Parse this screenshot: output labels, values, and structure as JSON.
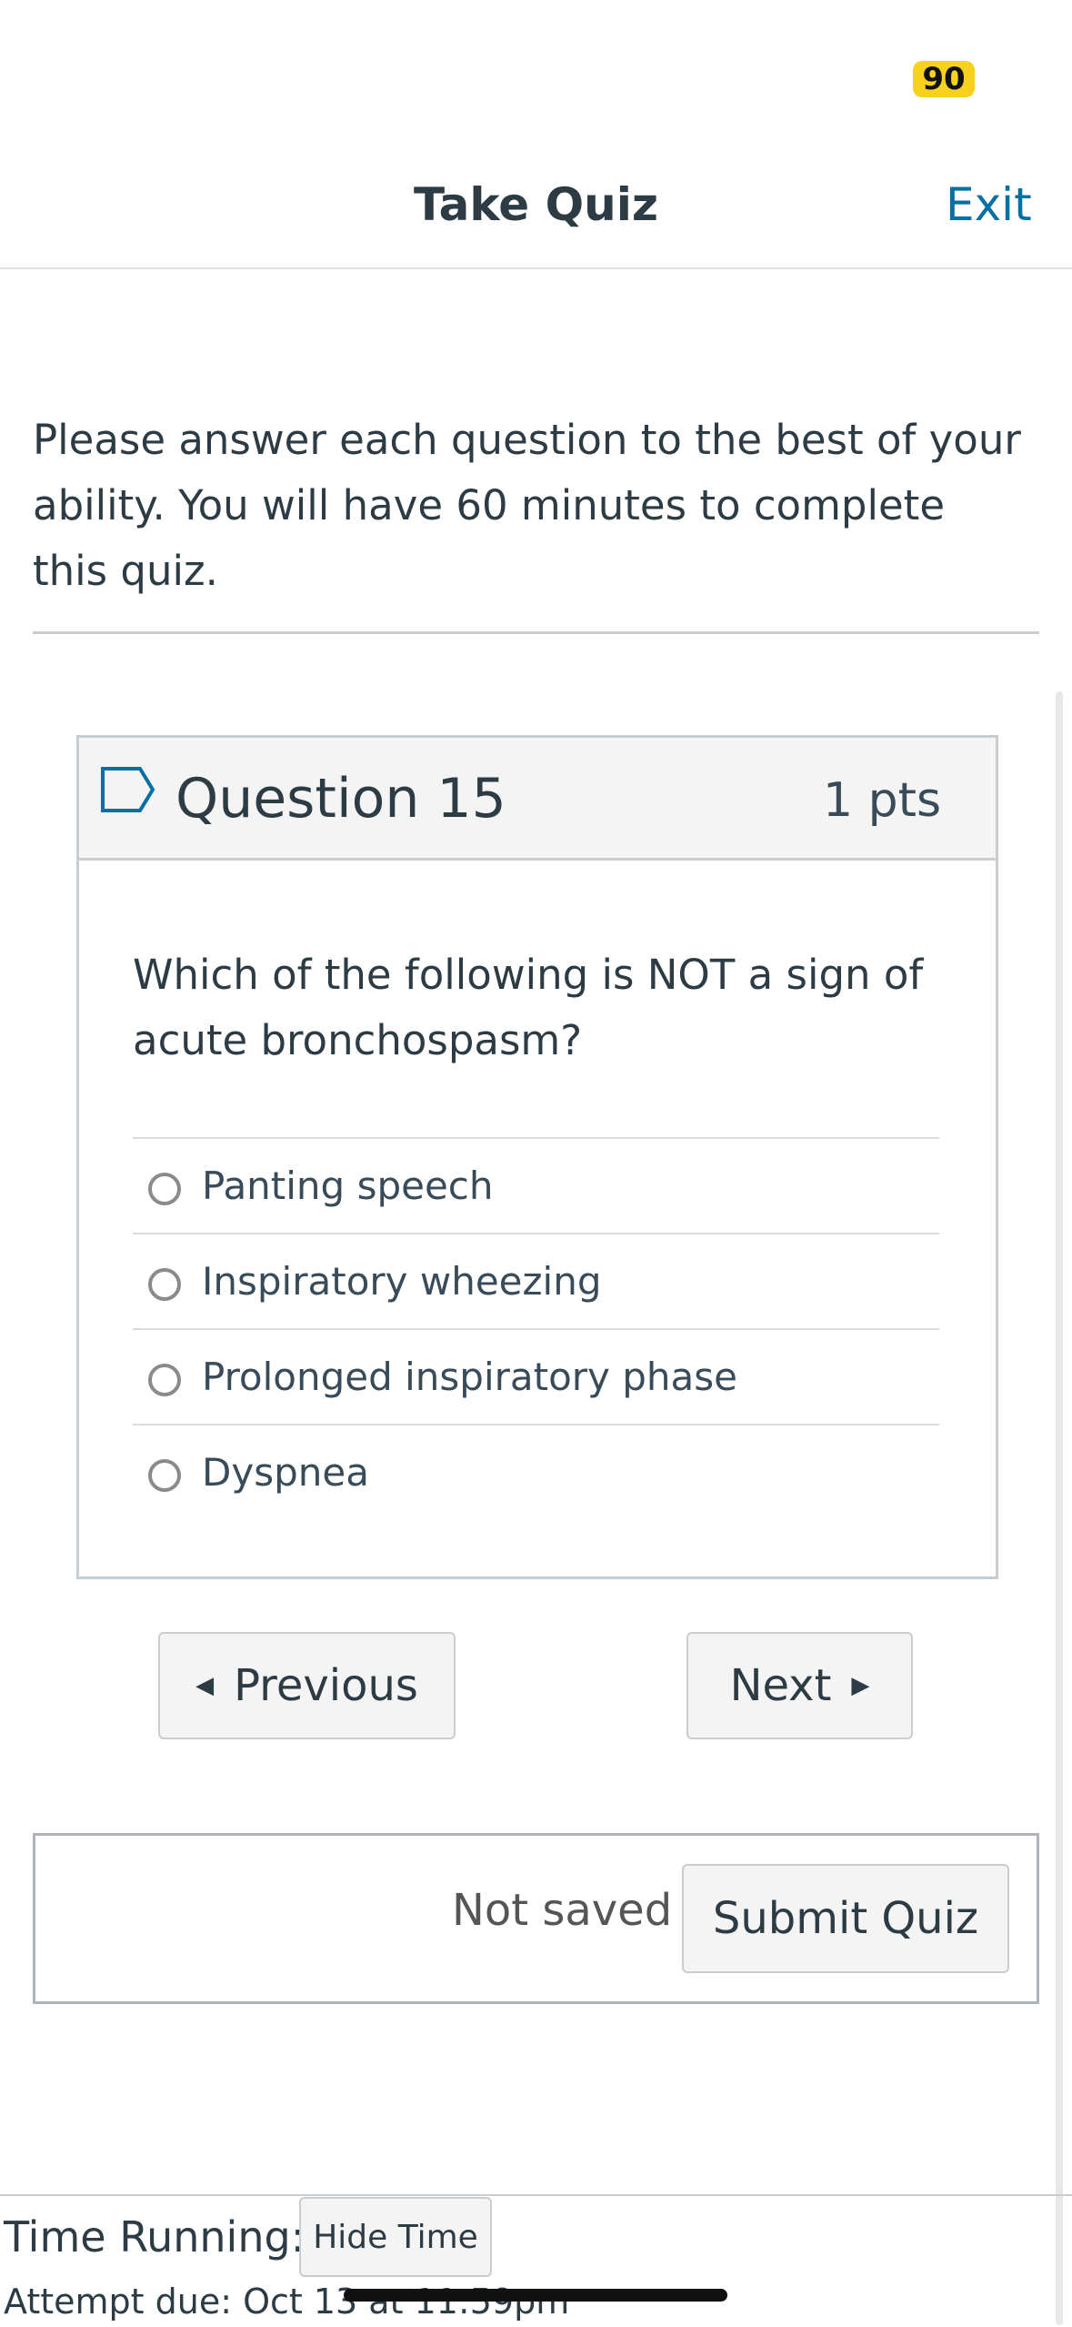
{
  "status": {
    "badge": "90"
  },
  "header": {
    "title": "Take Quiz",
    "exit_label": "Exit"
  },
  "intro": "Please answer each question to the best of your ability.  You will have 60 minutes to complete this quiz.",
  "question": {
    "title": "Question 15",
    "points": "1 pts",
    "text": "Which of the following is NOT a sign of acute bronchospasm?",
    "options": [
      "Panting speech",
      "Inspiratory wheezing",
      "Prolonged inspiratory phase",
      "Dyspnea"
    ]
  },
  "nav": {
    "previous_label": "Previous",
    "next_label": "Next"
  },
  "save": {
    "status": "Not saved",
    "submit_label": "Submit Quiz"
  },
  "timer": {
    "label": "Time Running:",
    "hide_label": "Hide Time",
    "attempt_due": "Attempt due: Oct 13 at 11:59pm"
  },
  "icons": {
    "flag": "flag-outline-icon",
    "prev": "caret-left-icon",
    "next": "caret-right-icon"
  },
  "colors": {
    "accent": "#0770a3",
    "badge": "#f6d11e"
  }
}
